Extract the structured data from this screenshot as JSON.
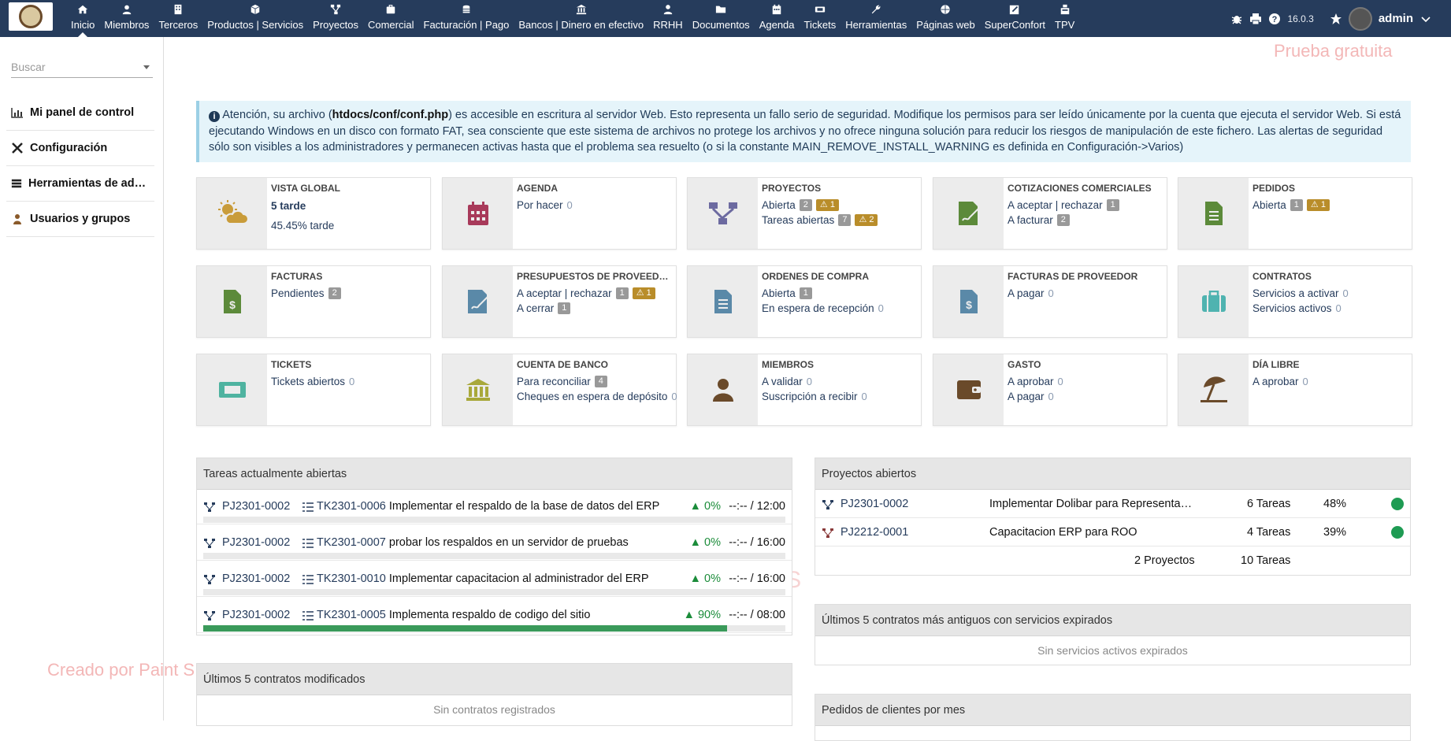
{
  "topbar": {
    "menu": [
      {
        "label": "Inicio",
        "icon": "home-icon"
      },
      {
        "label": "Miembros",
        "icon": "member-icon"
      },
      {
        "label": "Terceros",
        "icon": "building-icon"
      },
      {
        "label": "Productos | Servicios",
        "icon": "cube-icon"
      },
      {
        "label": "Proyectos",
        "icon": "project-icon"
      },
      {
        "label": "Comercial",
        "icon": "briefcase-icon"
      },
      {
        "label": "Facturación | Pago",
        "icon": "coins-icon"
      },
      {
        "label": "Bancos | Dinero en efectivo",
        "icon": "bank-icon"
      },
      {
        "label": "RRHH",
        "icon": "user-tie-icon"
      },
      {
        "label": "Documentos",
        "icon": "folder-icon"
      },
      {
        "label": "Agenda",
        "icon": "calendar-icon"
      },
      {
        "label": "Tickets",
        "icon": "ticket-icon"
      },
      {
        "label": "Herramientas",
        "icon": "wrench-icon"
      },
      {
        "label": "Páginas web",
        "icon": "globe-icon"
      },
      {
        "label": "SuperConfort",
        "icon": "edit-icon"
      },
      {
        "label": "TPV",
        "icon": "cash-register-icon"
      }
    ],
    "version": "16.0.3",
    "user": "admin"
  },
  "search": {
    "placeholder": "Buscar"
  },
  "leftnav": [
    {
      "label": "Mi panel de control",
      "icon": "chart-icon"
    },
    {
      "label": "Configuración",
      "icon": "tools-icon"
    },
    {
      "label": "Herramientas de administración",
      "icon": "server-icon"
    },
    {
      "label": "Usuarios y grupos",
      "icon": "user-icon"
    }
  ],
  "watermarks": {
    "trial": "Prueba gratuita",
    "created": "Creado por Paint S"
  },
  "alert": {
    "pre": "Atención, su archivo (",
    "file": "htdocs/conf/conf.php",
    "post": ") es accesible en escritura al servidor Web. Esto representa un fallo serio de seguridad. Modifique los permisos para ser leído únicamente por la cuenta que ejecuta el servidor Web. Si está ejecutando Windows en un disco con formato FAT, sea consciente que este sistema de archivos no protege los archivos y no ofrece ninguna solución para reducir los riesgos de manipulación de este fichero. Las alertas de seguridad sólo son visibles a los administradores y permanecen activas hasta que el problema sea resuelto (o si la constante MAIN_REMOVE_INSTALL_WARNING es definida en Configuración->Varios)"
  },
  "boxes": {
    "vista": {
      "title": "VISTA GLOBAL",
      "big": "5 tarde",
      "small": "45.45% tarde"
    },
    "agenda": {
      "title": "AGENDA",
      "l1": "Por hacer",
      "v1": "0"
    },
    "proyectos": {
      "title": "PROYECTOS",
      "l1": "Abierta",
      "b1": "2",
      "w1": "1",
      "l2": "Tareas abiertas",
      "b2": "7",
      "w2": "2"
    },
    "cotiz": {
      "title": "COTIZACIONES COMERCIALES",
      "l1": "A aceptar | rechazar",
      "b1": "1",
      "l2": "A facturar",
      "b2": "2"
    },
    "pedidos": {
      "title": "PEDIDOS",
      "l1": "Abierta",
      "b1": "1",
      "w1": "1"
    },
    "facturas": {
      "title": "FACTURAS",
      "l1": "Pendientes",
      "b1": "2"
    },
    "presup": {
      "title": "PRESUPUESTOS DE PROVEEDOR",
      "l1": "A aceptar | rechazar",
      "b1": "1",
      "w1": "1",
      "l2": "A cerrar",
      "b2": "1"
    },
    "ordenes": {
      "title": "ORDENES DE COMPRA",
      "l1": "Abierta",
      "b1": "1",
      "l2": "En espera de recepción",
      "v2": "0"
    },
    "factprov": {
      "title": "FACTURAS DE PROVEEDOR",
      "l1": "A pagar",
      "v1": "0"
    },
    "contratos": {
      "title": "CONTRATOS",
      "l1": "Servicios a activar",
      "v1": "0",
      "l2": "Servicios activos",
      "v2": "0"
    },
    "tickets": {
      "title": "TICKETS",
      "l1": "Tickets abiertos",
      "v1": "0"
    },
    "banco": {
      "title": "CUENTA DE BANCO",
      "l1": "Para reconciliar",
      "b1": "4",
      "l2": "Cheques en espera de depósito",
      "v2": "0"
    },
    "miembros": {
      "title": "MIEMBROS",
      "l1": "A validar",
      "v1": "0",
      "l2": "Suscripción a recibir",
      "v2": "0"
    },
    "gasto": {
      "title": "GASTO",
      "l1": "A aprobar",
      "v1": "0",
      "l2": "A pagar",
      "v2": "0"
    },
    "dialibre": {
      "title": "DÍA LIBRE",
      "l1": "A aprobar",
      "v1": "0"
    }
  },
  "tasks": {
    "title": "Tareas actualmente abiertas",
    "rows": [
      {
        "project": "PJ2301-0002",
        "ref": "TK2301-0006",
        "desc": "Implementar el respaldo de la base de datos del ERP",
        "pct": "0%",
        "time": "--:-- / 12:00",
        "progress": 0
      },
      {
        "project": "PJ2301-0002",
        "ref": "TK2301-0007",
        "desc": "probar los respaldos en un servidor de pruebas",
        "pct": "0%",
        "time": "--:-- / 16:00",
        "progress": 0
      },
      {
        "project": "PJ2301-0002",
        "ref": "TK2301-0010",
        "desc": "Implementar capacitacion al administrador del ERP",
        "pct": "0%",
        "time": "--:-- / 16:00",
        "progress": 0
      },
      {
        "project": "PJ2301-0002",
        "ref": "TK2301-0005",
        "desc": "Implementa respaldo de codigo del sitio",
        "pct": "90%",
        "time": "--:-- / 08:00",
        "progress": 90
      }
    ]
  },
  "contracts_mod": {
    "title": "Últimos 5 contratos modificados",
    "empty": "Sin contratos registrados"
  },
  "projects": {
    "title": "Proyectos abiertos",
    "rows": [
      {
        "ref": "PJ2301-0002",
        "name": "Implementar Dolibar para Representa…",
        "tasks": "6 Tareas",
        "pct": "48%"
      },
      {
        "ref": "PJ2212-0001",
        "name": "Capacitacion ERP para ROO",
        "tasks": "4 Tareas",
        "pct": "39%"
      }
    ],
    "total_projects": "2 Proyectos",
    "total_tasks": "10 Tareas"
  },
  "contracts_exp": {
    "title": "Últimos 5 contratos más antiguos con servicios expirados",
    "empty": "Sin servicios activos expirados"
  },
  "orders": {
    "title": "Pedidos de clientes por mes"
  },
  "colors": {
    "topbar": "#263c5c",
    "badge": "#999999",
    "warn": "#b98d2a",
    "green": "#1e9b53"
  }
}
